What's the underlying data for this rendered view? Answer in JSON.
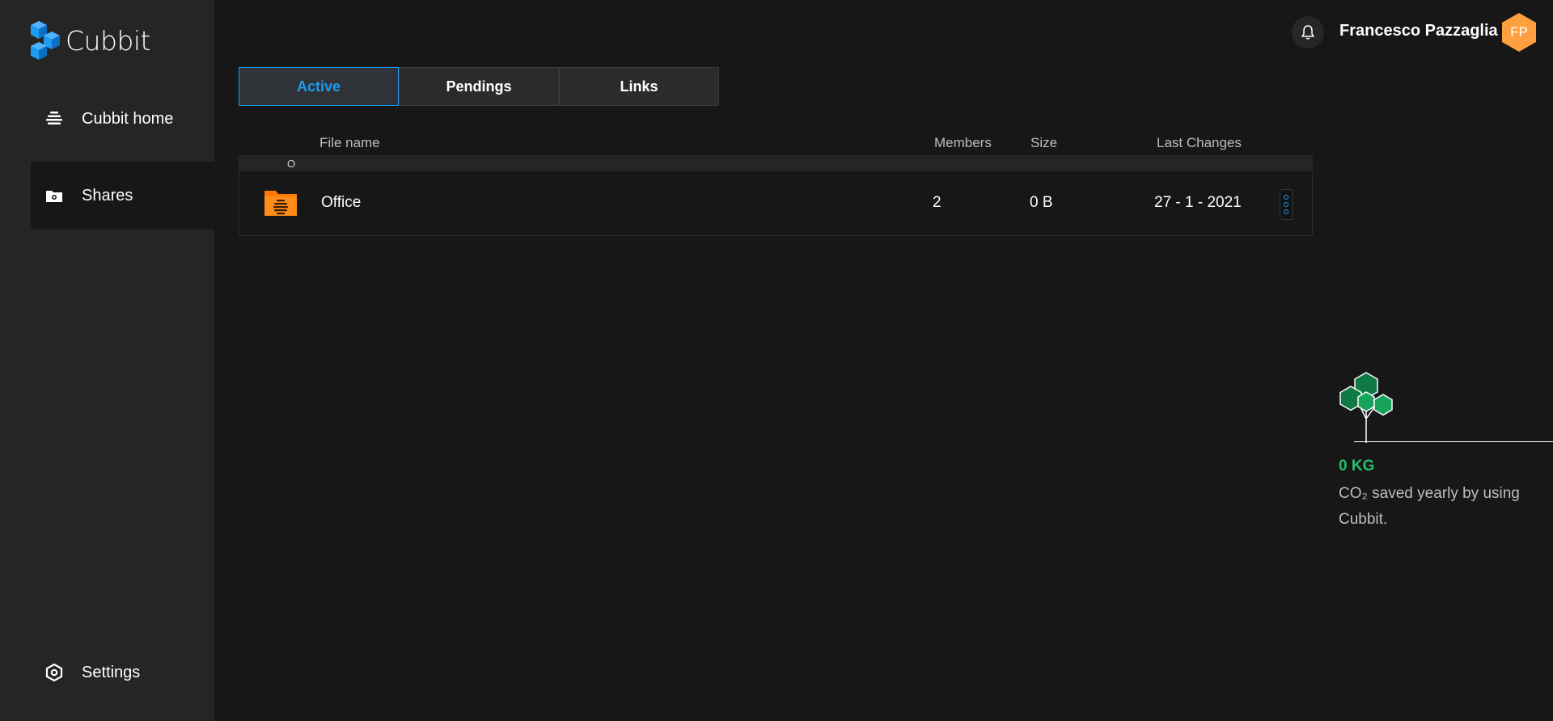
{
  "app": {
    "name": "Cubbit"
  },
  "sidebar": {
    "items": [
      {
        "label": "Cubbit home",
        "icon": "cubbit-home-icon"
      },
      {
        "label": "Shares",
        "icon": "shares-folder-icon",
        "active": true
      },
      {
        "label": "Settings",
        "icon": "gear-icon"
      }
    ]
  },
  "header": {
    "user_name": "Francesco Pazzaglia",
    "avatar_initials": "FP",
    "avatar_color": "#ff9f40"
  },
  "tabs": [
    {
      "label": "Active",
      "active": true
    },
    {
      "label": "Pendings",
      "active": false
    },
    {
      "label": "Links",
      "active": false
    }
  ],
  "table": {
    "columns": {
      "name": "File name",
      "members": "Members",
      "size": "Size",
      "last_changes": "Last Changes"
    },
    "group_label": "O",
    "rows": [
      {
        "name": "Office",
        "members": "2",
        "size": "0 B",
        "last_changes": "27 - 1 - 2021"
      }
    ]
  },
  "co2": {
    "value": "0 KG",
    "description": "CO₂ saved yearly by using Cubbit."
  },
  "colors": {
    "accent": "#1d9bf0",
    "folder": "#ff7a00",
    "co2_green": "#1fc46b"
  }
}
